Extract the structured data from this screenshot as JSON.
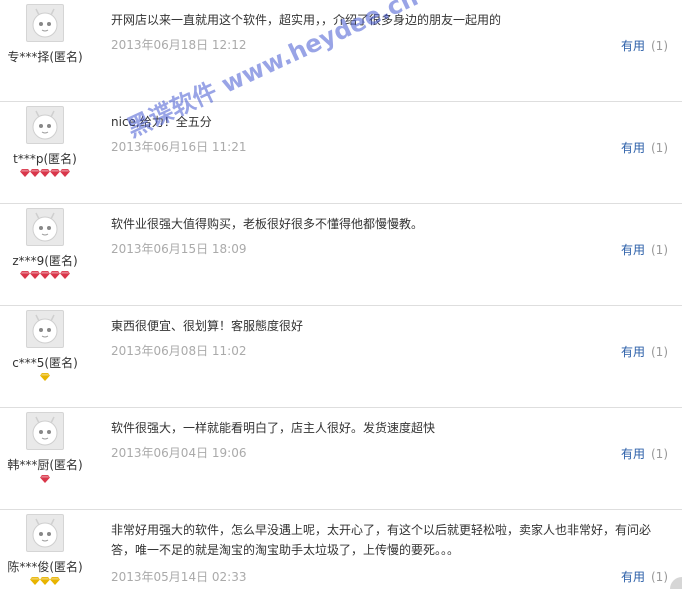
{
  "reviews": [
    {
      "user": "专***择(匿名)",
      "badge": "",
      "badge_count": 0,
      "content": "开网店以来一直就用这个软件，超实用，，介绍了很多身边的朋友一起用的",
      "date": "2013年06月18日 12:12",
      "useful_label": "有用",
      "useful_count": "(1)"
    },
    {
      "user": "t***p(匿名)",
      "badge": "red-diamond",
      "badge_count": 5,
      "content": "nice,给力！全五分",
      "date": "2013年06月16日 11:21",
      "useful_label": "有用",
      "useful_count": "(1)"
    },
    {
      "user": "z***9(匿名)",
      "badge": "red-diamond",
      "badge_count": 5,
      "content": "软件业很强大值得购买，老板很好很多不懂得他都慢慢教。",
      "date": "2013年06月15日 18:09",
      "useful_label": "有用",
      "useful_count": "(1)"
    },
    {
      "user": "c***5(匿名)",
      "badge": "gold-diamond",
      "badge_count": 1,
      "content": "東西很便宜、很划算！客服態度很好",
      "date": "2013年06月08日 11:02",
      "useful_label": "有用",
      "useful_count": "(1)"
    },
    {
      "user": "韩***厨(匿名)",
      "badge": "red-diamond",
      "badge_count": 1,
      "content": "软件很强大，一样就能看明白了，店主人很好。发货速度超快",
      "date": "2013年06月04日 19:06",
      "useful_label": "有用",
      "useful_count": "(1)"
    },
    {
      "user": "陈***俊(匿名)",
      "badge": "gold-diamond",
      "badge_count": 3,
      "content": "非常好用强大的软件，怎么早没遇上呢，太开心了，有这个以后就更轻松啦，卖家人也非常好，有问必答，唯一不足的就是淘宝的淘宝助手太垃圾了，上传慢的要死。。。",
      "date": "2013年05月14日 02:33",
      "useful_label": "有用",
      "useful_count": "(1)"
    }
  ],
  "watermark": {
    "text": "黑谍软件 www.heydee.cn"
  },
  "colors": {
    "link": "#2a5ea8",
    "date": "#aaaaaa",
    "red_badge": "#d9364a",
    "gold_badge": "#e8b400"
  }
}
